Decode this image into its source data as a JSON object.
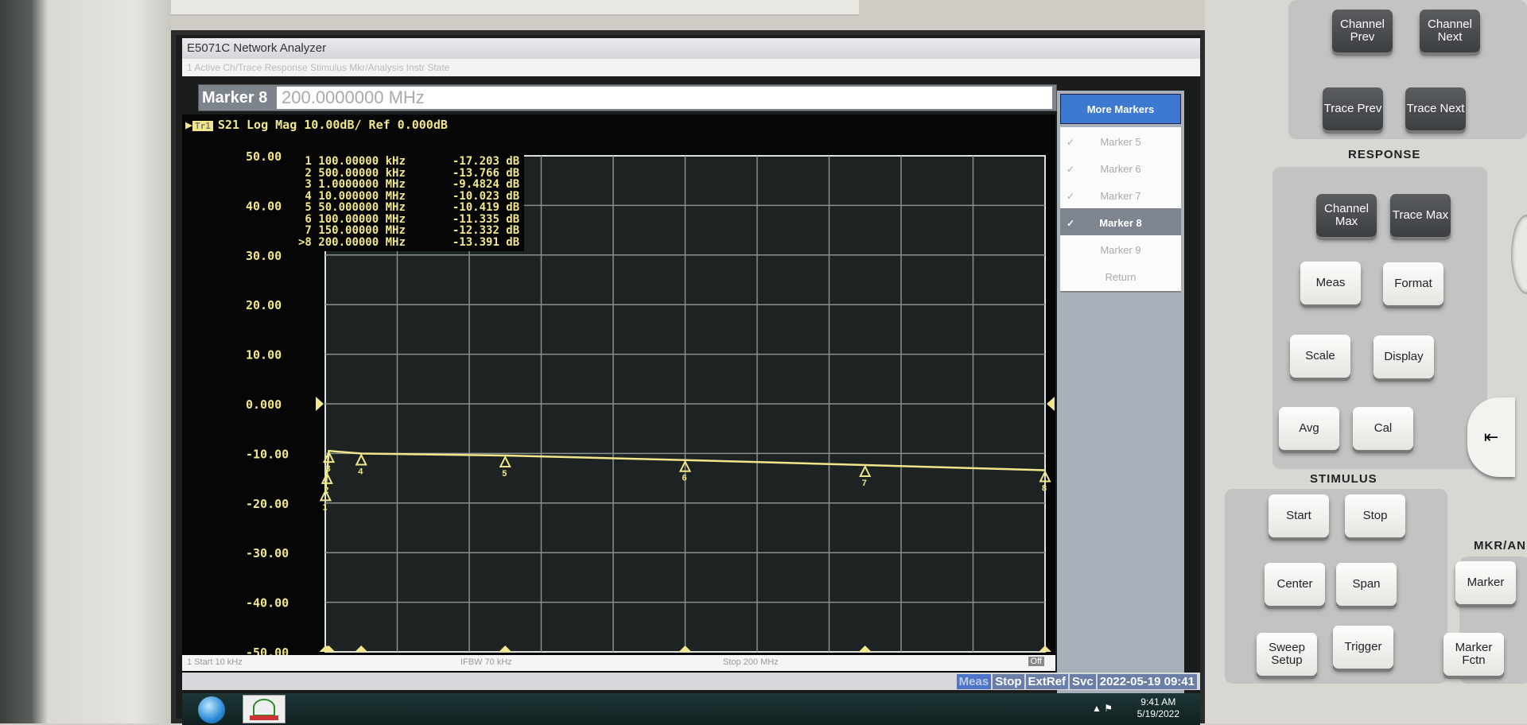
{
  "window": {
    "title": "E5071C Network Analyzer",
    "menu_text": "1 Active Ch/Trace   Response   Stimulus   Mkr/Analysis   Instr State"
  },
  "entry": {
    "label": "Marker 8",
    "value": "200.0000000 MHz"
  },
  "softkeys": {
    "title": "More Markers",
    "items": [
      {
        "label": "Marker 5",
        "checked": true
      },
      {
        "label": "Marker 6",
        "checked": true
      },
      {
        "label": "Marker 7",
        "checked": true
      },
      {
        "label": "Marker 8",
        "checked": true,
        "active": true
      },
      {
        "label": "Marker 9",
        "checked": false
      },
      {
        "label": "Return",
        "checked": false
      }
    ]
  },
  "trace": {
    "tr_label": "Tr1",
    "header": "S21 Log Mag 10.00dB/ Ref 0.000dB",
    "color": "#f2e68c"
  },
  "chart_data": {
    "type": "line",
    "ylim": [
      -50,
      50
    ],
    "xlim_mhz": [
      0.01,
      200
    ],
    "grid": true,
    "y_ticks": [
      "50.00",
      "40.00",
      "30.00",
      "20.00",
      "10.00",
      "0.000",
      "-10.00",
      "-20.00",
      "-30.00",
      "-40.00",
      "-50.00"
    ],
    "reference_level": 0,
    "markers": [
      {
        "id": "1",
        "freq": "100.00000 kHz",
        "freq_mhz": 0.1,
        "value": "-17.203 dB",
        "db": -17.203
      },
      {
        "id": "2",
        "freq": "500.00000 kHz",
        "freq_mhz": 0.5,
        "value": "-13.766 dB",
        "db": -13.766
      },
      {
        "id": "3",
        "freq": "1.0000000 MHz",
        "freq_mhz": 1,
        "value": "-9.4824 dB",
        "db": -9.4824
      },
      {
        "id": "4",
        "freq": "10.000000 MHz",
        "freq_mhz": 10,
        "value": "-10.023 dB",
        "db": -10.023
      },
      {
        "id": "5",
        "freq": "50.000000 MHz",
        "freq_mhz": 50,
        "value": "-10.419 dB",
        "db": -10.419
      },
      {
        "id": "6",
        "freq": "100.00000 MHz",
        "freq_mhz": 100,
        "value": "-11.335 dB",
        "db": -11.335
      },
      {
        "id": "7",
        "freq": "150.00000 MHz",
        "freq_mhz": 150,
        "value": "-12.332 dB",
        "db": -12.332
      },
      {
        "id": ">8",
        "freq": "200.00000 MHz",
        "freq_mhz": 200,
        "value": "-13.391 dB",
        "db": -13.391
      }
    ]
  },
  "statusline": {
    "start": "1  Start 10 kHz",
    "ifbw": "IFBW 70 kHz",
    "stop": "Stop 200 MHz",
    "off": "Off"
  },
  "statusbar": {
    "items": [
      "Meas",
      "Stop",
      "ExtRef",
      "Svc",
      "2022-05-19 09:41"
    ]
  },
  "taskbar": {
    "time": "9:41 AM",
    "date": "5/19/2022"
  },
  "panel": {
    "channel_prev": "Channel Prev",
    "channel_next": "Channel Next",
    "trace_prev": "Trace Prev",
    "trace_next": "Trace Next",
    "response": "RESPONSE",
    "channel_max": "Channel Max",
    "trace_max": "Trace Max",
    "meas": "Meas",
    "format": "Format",
    "scale": "Scale",
    "display": "Display",
    "avg": "Avg",
    "cal": "Cal",
    "stimulus": "STIMULUS",
    "start": "Start",
    "stop": "Stop",
    "center": "Center",
    "span": "Span",
    "sweep_setup": "Sweep Setup",
    "trigger": "Trigger",
    "mkr_analysis": "MKR/AN",
    "marker": "Marker",
    "marker_fctn": "Marker Fctn"
  }
}
